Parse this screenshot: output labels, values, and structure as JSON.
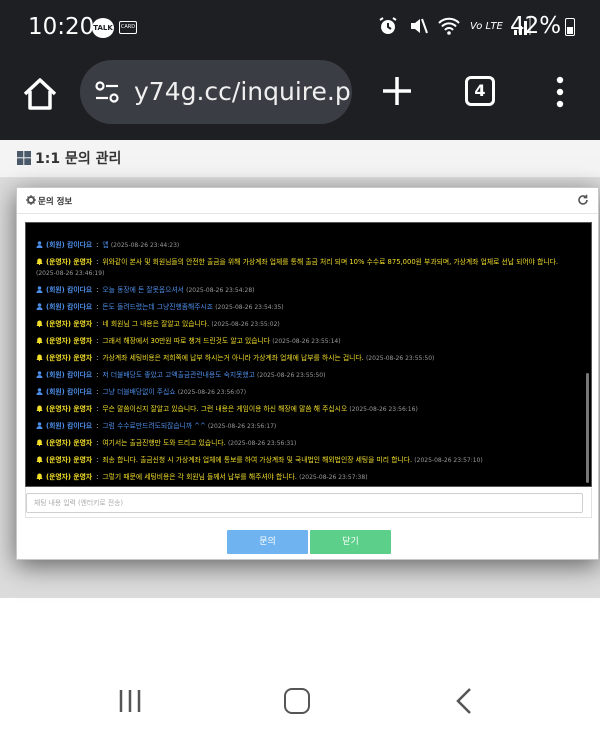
{
  "status_bar": {
    "time": "10:20",
    "talk_badge": "TALK",
    "card_badge": "CARD",
    "signal_label": "Vo LTE",
    "battery": "42%"
  },
  "browser": {
    "url": "y74g.cc/inquire.p",
    "tab_count": "4"
  },
  "page": {
    "title": "1:1 문의 관리"
  },
  "dialog": {
    "title": "문의 정보",
    "messages": [
      {
        "role": "member",
        "who": "(회원) 캄이다요",
        "text": "앱",
        "time": "(2025-08-26 23:44:23)"
      },
      {
        "role": "op",
        "who": "(운영자) 운영자",
        "text": "위와같이 본사 및 회원님들의 안전한 출금을 위해 가상계좌 업체를 통해 출금 처리 되며 10% 수수료 875,000원 부과되며, 가상계좌 업체로 선납 되어야 합니다.",
        "time": "(2025-08-26 23:46:19)"
      },
      {
        "role": "member",
        "who": "(회원) 캄이다요",
        "text": "오늘 동장에 돈 잘못옵으셔서",
        "time": "(2025-08-26 23:54:28)"
      },
      {
        "role": "member",
        "who": "(회원) 캄이다요",
        "text": "돈도 돌려드렸는데 그냥진행좀해주시죠",
        "time": "(2025-08-26 23:54:35)"
      },
      {
        "role": "op",
        "who": "(운영자) 운영자",
        "text": "네 회원님 그 내용은 잘알고 있습니다.",
        "time": "(2025-08-26 23:55:02)"
      },
      {
        "role": "op",
        "who": "(운영자) 운영자",
        "text": "그래서 해장에서 30만원 따로 챙겨 드린것도 알고 있습니다",
        "time": "(2025-08-26 23:55:14)"
      },
      {
        "role": "op",
        "who": "(운영자) 운영자",
        "text": "가상계좌 세팅비용은 저희쪽에 납부 하시는거 아니라 가상계좌 업체에 납부를 하시는 겁니다.",
        "time": "(2025-08-26 23:55:50)"
      },
      {
        "role": "member",
        "who": "(회원) 캄이다요",
        "text": "저 더불배당도 좋았고 고액출금관련내용도 숙지못했고",
        "time": "(2025-08-26 23:55:50)"
      },
      {
        "role": "member",
        "who": "(회원) 캄이다요",
        "text": "그냥 더블배당없이 주십쇼",
        "time": "(2025-08-26 23:56:07)"
      },
      {
        "role": "op",
        "who": "(운영자) 운영자",
        "text": "무슨 말씀이신지 잘알고 있습니다. 그런 내용은 게임이용 하신 해장에 말씀 해 주십시오",
        "time": "(2025-08-26 23:56:16)"
      },
      {
        "role": "member",
        "who": "(회원) 캄이다요",
        "text": "그럼 수수료만드려도되잖습니까 ^^",
        "time": "(2025-08-26 23:56:17)"
      },
      {
        "role": "op",
        "who": "(운영자) 운영자",
        "text": "여기서는 출금진행만 도와 드리고 있습니다.",
        "time": "(2025-08-26 23:56:31)"
      },
      {
        "role": "op",
        "who": "(운영자) 운영자",
        "text": "죄송 합니다. 출금신청 시 가상계좌 업체에 통보를 하여 가상계좌 및 국내법인 해외법인장 세팅을 미리 합니다.",
        "time": "(2025-08-26 23:57:10)"
      },
      {
        "role": "op",
        "who": "(운영자) 운영자",
        "text": "그렇기 때문에 세팅비용은 각 회원님 들께서 납부를 해주셔야 합니다.",
        "time": "(2025-08-26 23:57:38)"
      }
    ],
    "input_placeholder": "채팅 내용 입력 (엔터키로 전송)",
    "ask_button": "문의",
    "close_button": "닫기"
  },
  "colors": {
    "member": "#4d8ee8",
    "operator": "#f4df2a",
    "ask_button": "#6fb3f0",
    "close_button": "#5ccf8a"
  }
}
